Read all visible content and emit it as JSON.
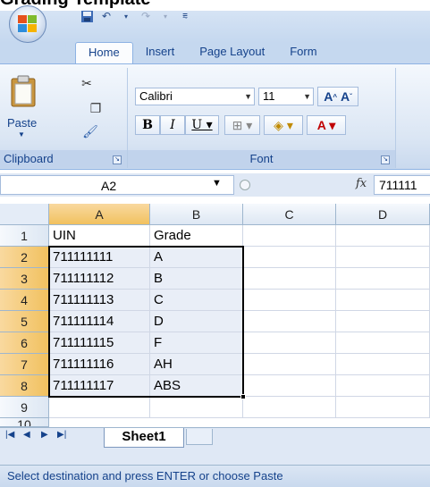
{
  "heading": "Grading Template",
  "ribbon": {
    "tabs": [
      "Home",
      "Insert",
      "Page Layout",
      "Form"
    ],
    "clipboard": {
      "label": "Clipboard",
      "paste_label": "Paste"
    },
    "font": {
      "label": "Font",
      "name": "Calibri",
      "size": "11"
    }
  },
  "formula_bar": {
    "name_box": "A2",
    "fx": "fx",
    "value": "711111"
  },
  "columns": [
    "A",
    "B",
    "C",
    "D"
  ],
  "rows": [
    "1",
    "2",
    "3",
    "4",
    "5",
    "6",
    "7",
    "8",
    "9",
    "10"
  ],
  "cells": [
    [
      "UIN",
      "Grade"
    ],
    [
      "711111111",
      "A"
    ],
    [
      "711111112",
      "B"
    ],
    [
      "711111113",
      "C"
    ],
    [
      "711111114",
      "D"
    ],
    [
      "711111115",
      "F"
    ],
    [
      "711111116",
      "AH"
    ],
    [
      "711111117",
      "ABS"
    ]
  ],
  "sheet_tab": "Sheet1",
  "status": "Select destination and press ENTER or choose Paste",
  "colors": {
    "accent": "#15428b",
    "selection": "#f1c15f",
    "ribbon": "#dbe6f4"
  }
}
